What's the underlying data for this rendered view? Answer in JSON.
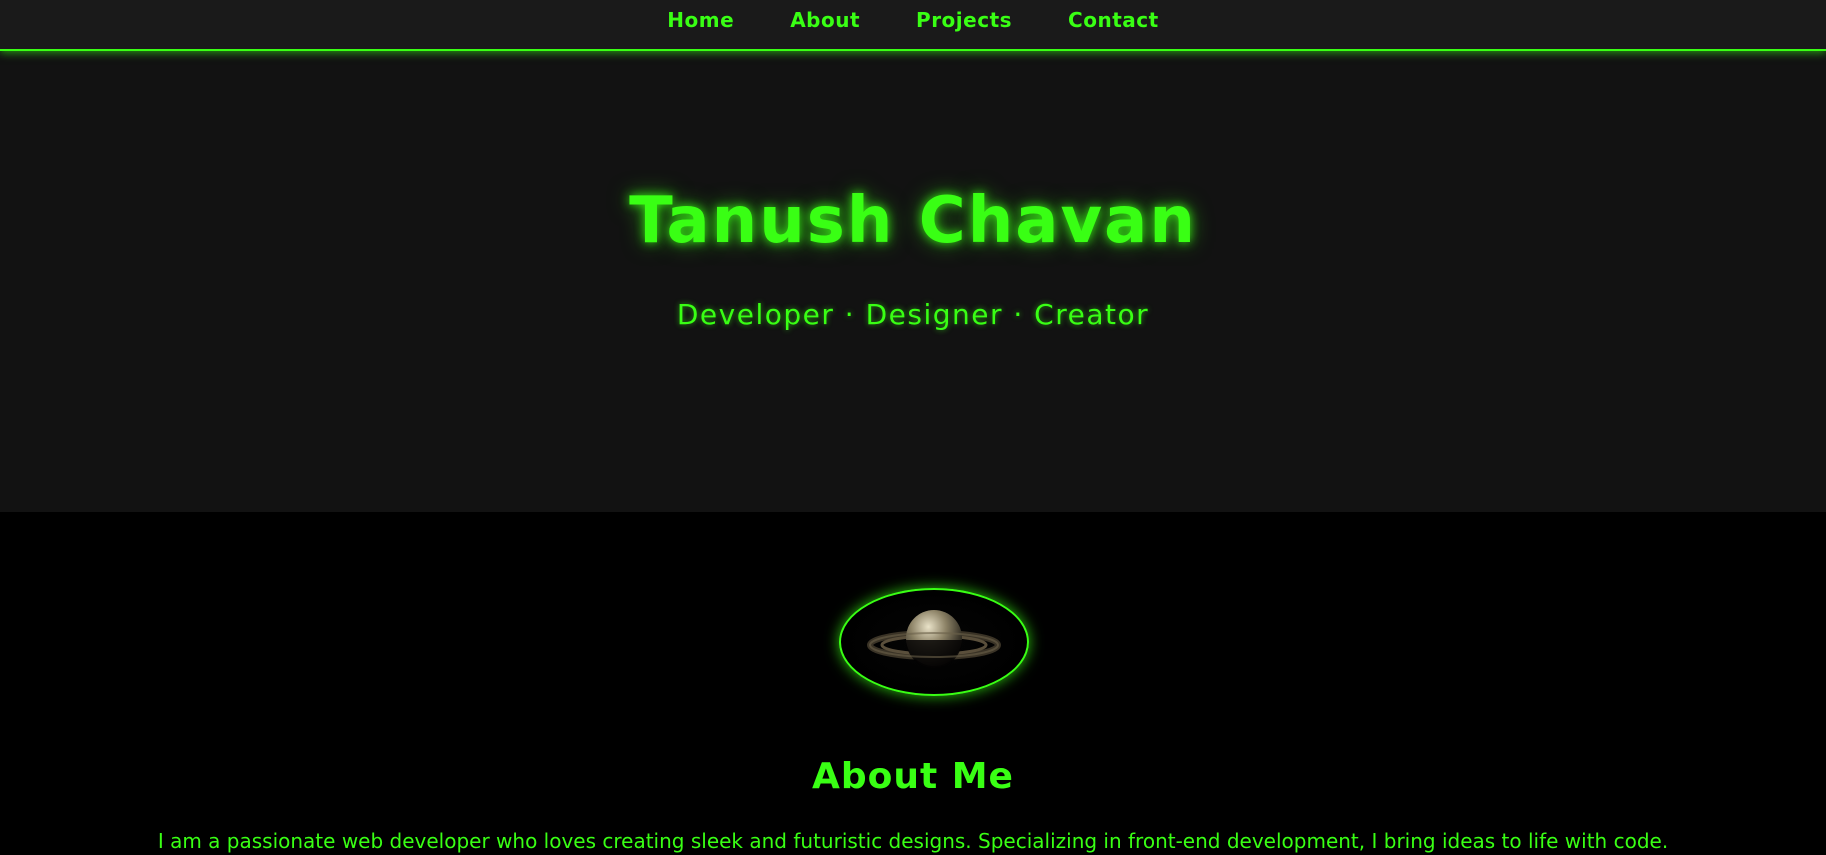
{
  "nav": {
    "items": [
      {
        "label": "Home"
      },
      {
        "label": "About"
      },
      {
        "label": "Projects"
      },
      {
        "label": "Contact"
      }
    ]
  },
  "hero": {
    "title": "Tanush Chavan",
    "tagline": "Developer · Designer · Creator"
  },
  "about": {
    "heading": "About Me",
    "text": "I am a passionate web developer who loves creating sleek and futuristic designs. Specializing in front-end development, I bring ideas to life with code."
  },
  "colors": {
    "accent": "#39ff14",
    "navbar_bg": "#1a1a1a",
    "hero_bg": "#121212",
    "page_bg": "#000000"
  },
  "icons": {
    "avatar": "planet-with-rings-icon"
  }
}
